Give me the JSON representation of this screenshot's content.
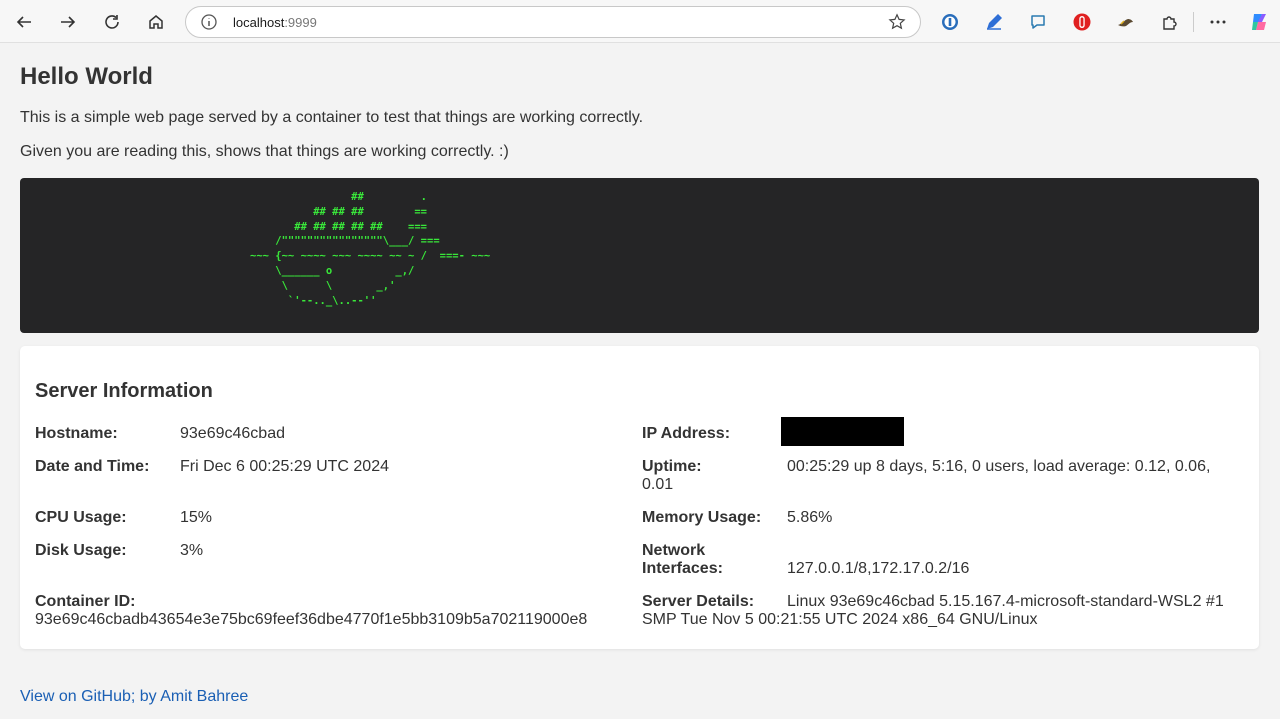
{
  "browser": {
    "url_host": "localhost",
    "url_port": ":9999",
    "icons": [
      "back-icon",
      "forward-icon",
      "refresh-icon",
      "home-icon",
      "info-icon",
      "star-icon",
      "password-manager-icon",
      "pen-extension-icon",
      "chat-extension-icon",
      "red-extension-icon",
      "bird-extension-icon",
      "puzzle-extension-icon",
      "more-icon",
      "copilot-icon"
    ]
  },
  "page": {
    "title": "Hello World",
    "intro": "This is a simple web page served by a container to test that things are working correctly.",
    "reading": "Given you are reading this, shows that things are working correctly. :)",
    "ascii_art": "                ##         .\n          ## ## ##        ==\n       ## ## ## ## ##    ===\n    /\"\"\"\"\"\"\"\"\"\"\"\"\"\"\"\"\\___/ ===\n~~~ {~~ ~~~~ ~~~ ~~~~ ~~ ~ /  ===- ~~~\n    \\______ o          _,/\n     \\      \\       _,'\n      `'--.._\\..--''",
    "ascii_color": "#39e83a"
  },
  "server": {
    "heading": "Server Information",
    "hostname_label": "Hostname:",
    "hostname": "93e69c46cbad",
    "ip_label": "IP Address:",
    "datetime_label": "Date and Time:",
    "datetime": "Fri Dec 6 00:25:29 UTC 2024",
    "uptime_label": "Uptime:",
    "uptime_line1": "00:25:29 up 8 days, 5:16, 0 users, load average: 0.12, 0.06,",
    "uptime_line2": "0.01",
    "cpu_label": "CPU Usage:",
    "cpu": "15%",
    "memory_label": "Memory Usage:",
    "memory": "5.86%",
    "disk_label": "Disk Usage:",
    "disk": "3%",
    "network_label_1": "Network",
    "network_label_2": "Interfaces:",
    "network": "127.0.0.1/8,172.17.0.2/16",
    "container_label": "Container ID:",
    "container_id": "93e69c46cbadb43654e3e75bc69feef36dbe4770f1e5bb3109b5a702119000e8",
    "details_label": "Server Details:",
    "details_line1": "Linux 93e69c46cbad 5.15.167.4-microsoft-standard-WSL2 #1",
    "details_line2": "SMP Tue Nov 5 00:21:55 UTC 2024 x86_64 GNU/Linux"
  },
  "footer": {
    "link": "View on GitHub; by Amit Bahree"
  }
}
